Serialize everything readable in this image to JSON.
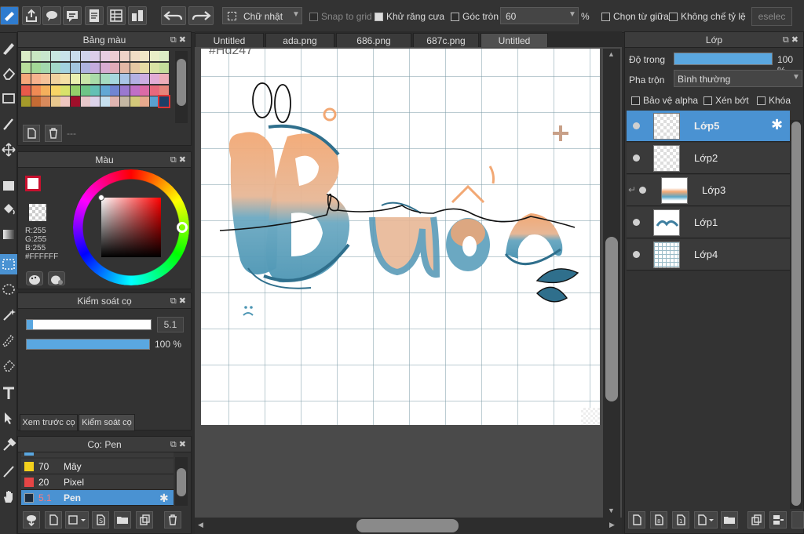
{
  "toolbar": {
    "shape_select": "Chữ nhật",
    "snap_to_grid": "Snap to grid",
    "antialias": "Khử răng cưa",
    "round_corner": "Góc tròn",
    "round_value": "60",
    "percent": "%",
    "from_center": "Chọn từ giữa",
    "no_ratio": "Không chế tỷ lệ",
    "deselect": "eselec"
  },
  "palette": {
    "title": "Bảng màu",
    "dash": "---",
    "rows": [
      [
        "#d9ecc6",
        "#c9e8c2",
        "#c8e6cd",
        "#c8e7df",
        "#c9e3ea",
        "#c9dceb",
        "#cfd3ea",
        "#dccde9",
        "#e7cde2",
        "#eccdd2",
        "#efd3c8",
        "#f1ddc6",
        "#f0e8c7",
        "#e9eec7",
        "#dcecc6"
      ],
      [
        "#b8df9b",
        "#a3d896",
        "#a3d8ad",
        "#a3d9c8",
        "#a3d2df",
        "#a3c6df",
        "#aeb3df",
        "#c4acdd",
        "#d7acd1",
        "#dfacb8",
        "#e3b8a6",
        "#e6c8a3",
        "#e6dca4",
        "#d9e3a4",
        "#c3dd9b"
      ],
      [
        "#f6a77a",
        "#f7b38e",
        "#f5c39a",
        "#f0d29f",
        "#f4e0a6",
        "#eaf0b0",
        "#c9e5a8",
        "#a9dca9",
        "#a5dcc1",
        "#a6d7dd",
        "#a9c5e6",
        "#b3b0e4",
        "#cdaee2",
        "#e2acd6",
        "#eeadb9"
      ],
      [
        "#e85a4a",
        "#f08a54",
        "#f4b05c",
        "#f7d566",
        "#d8e26b",
        "#94cf6a",
        "#6dc486",
        "#63c0b5",
        "#62a8d5",
        "#7185d2",
        "#9a78cf",
        "#c070c6",
        "#dc6aa6",
        "#e7687c",
        "#e5847a"
      ],
      [
        "#a49a2a",
        "#c56b34",
        "#d88a5c",
        "#e8c88e",
        "#efc6c0",
        "#a00f2a",
        "#e7c7c9",
        "#dcd3ea",
        "#c7e0ef",
        "#e0b5b1",
        "#c4b7a3",
        "#d3c97a",
        "#e7a98d",
        "#5aa0d0",
        "#1c3f66"
      ]
    ]
  },
  "color": {
    "title": "Màu",
    "r": "R:255",
    "g": "G:255",
    "b": "B:255",
    "hex": "#FFFFFF"
  },
  "brush_control": {
    "title": "Kiểm soát cọ",
    "size": "5.1",
    "size_fraction": 0.05,
    "opacity": "100 %",
    "opacity_fraction": 1.0
  },
  "side_tabs": {
    "preview": "Xem trước cọ",
    "control": "Kiểm soát cọ"
  },
  "brush_list": {
    "title": "Cọ: Pen",
    "items": [
      {
        "value": "70",
        "name": "Mây",
        "color": "#f3d01c"
      },
      {
        "value": "20",
        "name": "Pixel",
        "color": "#e64545"
      },
      {
        "value": "5.1",
        "name": "Pen",
        "color": "#1d2c3d"
      }
    ]
  },
  "tabs": [
    "Untitled",
    "ada.png",
    "686.png",
    "687c.png",
    "Untitled"
  ],
  "canvas": {
    "tag": "#Hd247"
  },
  "layers": {
    "title": "Lớp",
    "opacity_label": "Độ trong",
    "opacity_value": "100 %",
    "opacity_fraction": 1.0,
    "blend_label": "Pha trộn",
    "blend_value": "Bình thường",
    "protect_alpha": "Bảo vệ alpha",
    "clipping": "Xén bớt",
    "lock": "Khóa",
    "items": [
      "Lớp5",
      "Lớp2",
      "Lớp3",
      "Lớp1",
      "Lớp4"
    ]
  }
}
